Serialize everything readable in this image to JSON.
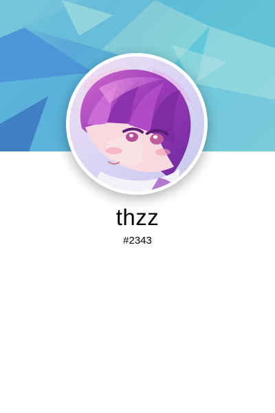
{
  "profile": {
    "username": "thzz",
    "user_id": "#2343"
  },
  "colors": {
    "banner_blue": "#5aa6d8",
    "banner_teal": "#78cfd8",
    "banner_light": "#a8e0df",
    "avatar_purple": "#a14ab6",
    "text": "#000000"
  },
  "icons": {
    "avatar": "anime-character-avatar"
  }
}
